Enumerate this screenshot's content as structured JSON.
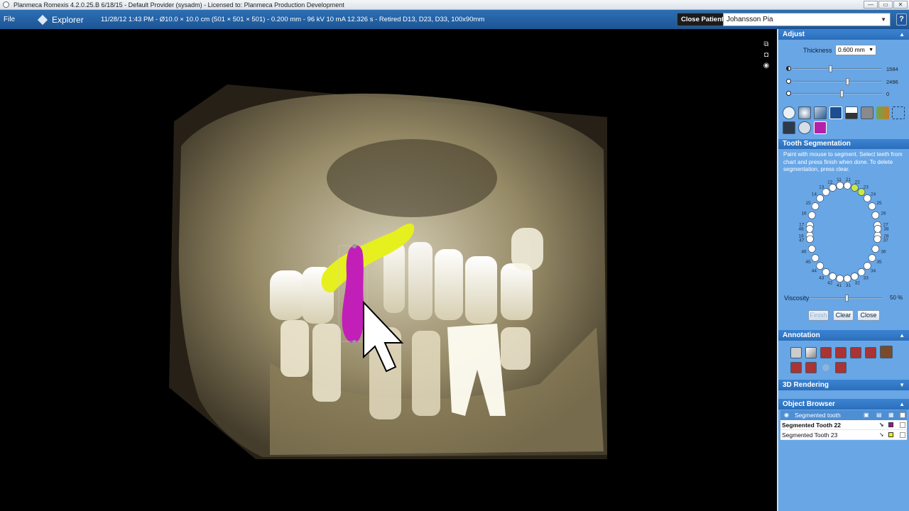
{
  "titlebar": {
    "title": "Planmeca Romexis 4.2.0.25.B  6/18/15 - Default Provider (sysadm) - Licensed to: Planmeca Production Development",
    "minimize": "—",
    "maximize": "▭",
    "close": "✕"
  },
  "toolbar": {
    "file": "File",
    "explorer": "Explorer",
    "info": "11/28/12 1:43 PM - Ø10.0 × 10.0 cm (501 × 501 × 501) - 0.200 mm - 96 kV 10 mA 12.326 s - Retired D13, D23, D33, 100x90mm",
    "close_patient": "Close Patient",
    "patient": "Johansson Pia",
    "help": "?"
  },
  "adjust": {
    "title": "Adjust",
    "thickness_label": "Thickness",
    "thickness_value": "0.600 mm",
    "sliders": [
      {
        "name": "brightness",
        "value": "1584",
        "level": 0.42
      },
      {
        "name": "contrast",
        "value": "2496",
        "level": 0.62
      },
      {
        "name": "opacity",
        "value": "0",
        "level": 0.55
      }
    ]
  },
  "tooth_segmentation": {
    "title": "Tooth Segmentation",
    "instructions": "Paint with mouse to segment. Select teeth from chart and press finish when done. To delete segmentation, press clear.",
    "upper_numbers": [
      "18",
      "17",
      "16",
      "15",
      "14",
      "13",
      "12",
      "11",
      "21",
      "22",
      "23",
      "24",
      "25",
      "26",
      "27",
      "28"
    ],
    "lower_numbers": [
      "48",
      "47",
      "46",
      "45",
      "44",
      "43",
      "42",
      "41",
      "31",
      "32",
      "33",
      "34",
      "35",
      "36",
      "37",
      "38"
    ],
    "viscosity_label": "Viscosity",
    "viscosity_value": "50 %",
    "viscosity_level": 0.5,
    "finish": "Finish",
    "clear": "Clear",
    "close": "Close",
    "highlight_color": "#c8e84a"
  },
  "annotation": {
    "title": "Annotation"
  },
  "rendering": {
    "title": "3D Rendering"
  },
  "object_browser": {
    "title": "Object Browser",
    "group": "Segmented tooth",
    "items": [
      {
        "label": "Segmented Tooth 22",
        "color": "#a0109a"
      },
      {
        "label": "Segmented Tooth 23",
        "color": "#f0f000"
      }
    ]
  },
  "colors": {
    "panel_bg": "#68a6e6",
    "header_bg": "#2c6fbb",
    "toolbar_bg": "#1c5594",
    "bone": "#d8cfa8",
    "tooth_22": "#c21fb8",
    "tooth_23": "#e6f01e"
  }
}
